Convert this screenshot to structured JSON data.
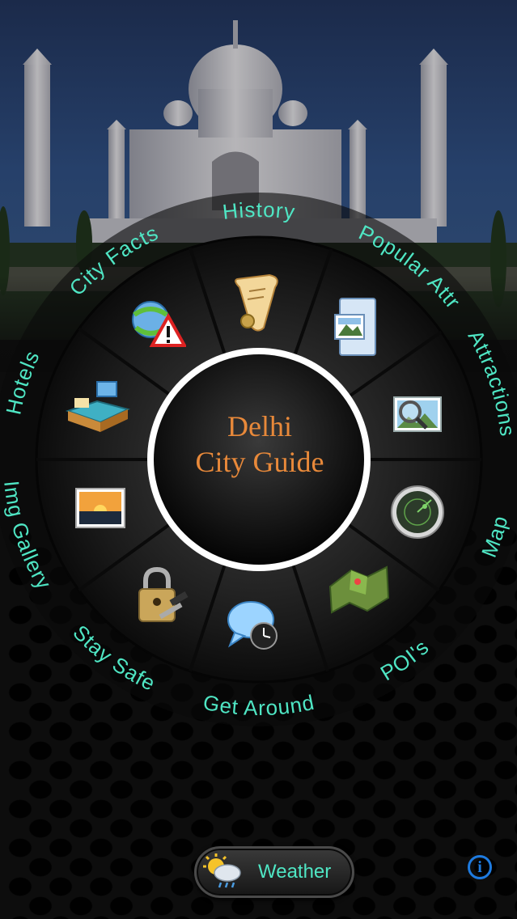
{
  "app": {
    "title_line1": "Delhi",
    "title_line2": "City Guide",
    "accent_color": "#e8893a",
    "label_color": "#4fe6c4"
  },
  "menu": {
    "items": [
      {
        "label": "History",
        "icon": "scroll-icon"
      },
      {
        "label": "Popular Attr",
        "icon": "photo-document-icon"
      },
      {
        "label": "Attractions",
        "icon": "magnifier-photo-icon"
      },
      {
        "label": "Map",
        "icon": "radar-icon"
      },
      {
        "label": "POI's",
        "icon": "terrain-map-icon"
      },
      {
        "label": "Get Around",
        "icon": "chat-clock-icon"
      },
      {
        "label": "Stay Safe",
        "icon": "padlock-key-icon"
      },
      {
        "label": "Img Gallery",
        "icon": "sunset-photo-icon"
      },
      {
        "label": "Hotels",
        "icon": "bed-icon"
      },
      {
        "label": "City Facts",
        "icon": "globe-warning-icon"
      }
    ]
  },
  "footer": {
    "weather_label": "Weather",
    "weather_icon": "sun-cloud-rain-icon",
    "info_icon": "info-icon"
  }
}
